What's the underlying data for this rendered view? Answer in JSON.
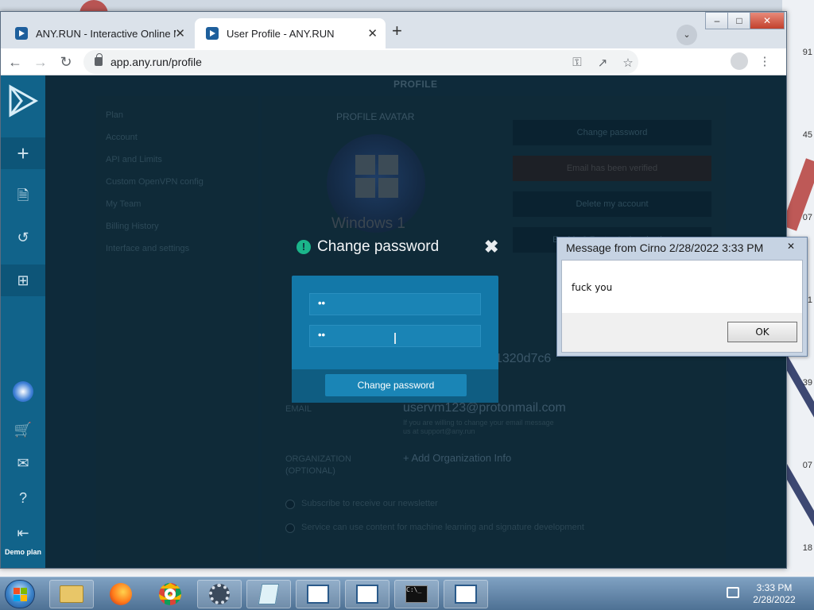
{
  "browser": {
    "tabs": [
      {
        "title": "ANY.RUN - Interactive Online Ma",
        "active": false
      },
      {
        "title": "User Profile - ANY.RUN",
        "active": true
      }
    ],
    "close_glyph": "✕",
    "new_tab_glyph": "+",
    "url": "app.any.run/profile"
  },
  "sidebar": {
    "items": [
      "plus-icon",
      "document-icon",
      "history-icon",
      "windows-icon",
      "windows-orb-icon",
      "cart-icon",
      "mail-icon",
      "help-icon",
      "logout-icon"
    ],
    "demo_label": "Demo plan"
  },
  "profile": {
    "title": "PROFILE",
    "nav": [
      "Plan",
      "Account",
      "API and Limits",
      "Custom OpenVPN config",
      "My Team",
      "Billing History",
      "Interface and settings"
    ],
    "avatar_label": "PROFILE AVATAR",
    "avatar_text": "Windows 1",
    "actions": [
      "Change password",
      "Email has been verified",
      "Delete my account",
      "Enable 2 Factor Authentication"
    ],
    "id_partial": "1320d7c6",
    "email_label": "EMAIL",
    "email": "uservm123@protonmail.com",
    "email_note": "If you are willing to change your email message us at support@any.run",
    "org_label": "ORGANIZATION (OPTIONAL)",
    "org_add": "+ Add Organization Info",
    "checkbox_newsletter": "Subscribe to receive our newsletter",
    "checkbox_ml": "Service can use content for machine learning and signature development"
  },
  "modal": {
    "icon": "!",
    "title": "Change password",
    "close_glyph": "✖",
    "field1_value": "••",
    "field2_value": "••",
    "button": "Change password"
  },
  "message_box": {
    "title": "Message from Cirno 2/28/2022 3:33 PM",
    "close_glyph": "✕",
    "text": "fuck you",
    "ok": "OK"
  },
  "desktop": {
    "edge_numbers": [
      "91",
      "45",
      "07",
      "1",
      "39",
      "07",
      "18"
    ]
  },
  "taskbar": {
    "time": "3:33 PM",
    "date": "2/28/2022"
  }
}
